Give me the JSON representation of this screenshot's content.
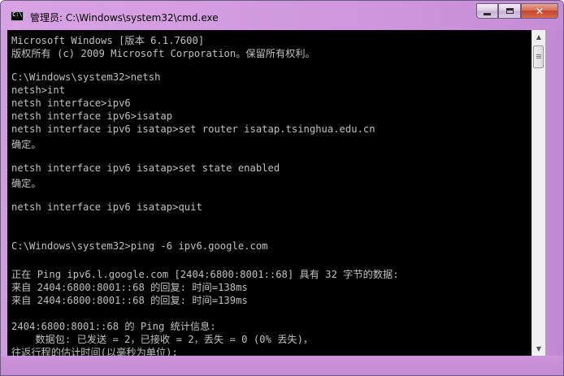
{
  "window": {
    "title": "管理员: C:\\Windows\\system32\\cmd.exe",
    "icon_label": "C:\\",
    "minimize_icon": "minimize-icon",
    "maximize_icon": "maximize-icon",
    "close_icon": "close-icon",
    "close_glyph": "✕"
  },
  "console": {
    "lines": [
      "Microsoft Windows [版本 6.1.7600]",
      "版权所有 (c) 2009 Microsoft Corporation。保留所有权利。",
      "",
      "C:\\Windows\\system32>netsh",
      "netsh>int",
      "netsh interface>ipv6",
      "netsh interface ipv6>isatap",
      "netsh interface ipv6 isatap>set router isatap.tsinghua.edu.cn",
      "确定。",
      "",
      "netsh interface ipv6 isatap>set state enabled",
      "确定。",
      "",
      "netsh interface ipv6 isatap>quit",
      "",
      "",
      "C:\\Windows\\system32>ping -6 ipv6.google.com",
      "",
      "正在 Ping ipv6.l.google.com [2404:6800:8001::68] 具有 32 字节的数据:",
      "来自 2404:6800:8001::68 的回复: 时间=138ms",
      "来自 2404:6800:8001::68 的回复: 时间=139ms",
      "",
      "2404:6800:8001::68 的 Ping 统计信息:",
      "    数据包: 已发送 = 2，已接收 = 2，丢失 = 0 (0% 丢失)，",
      "往返行程的估计时间(以毫秒为单位):"
    ]
  },
  "scrollbar": {
    "up_glyph": "▲",
    "down_glyph": "▼"
  },
  "colors": {
    "console_bg": "#000000",
    "console_fg": "#c0c0c0",
    "frame": "#d0a0e0",
    "close_button": "#c2452b"
  }
}
